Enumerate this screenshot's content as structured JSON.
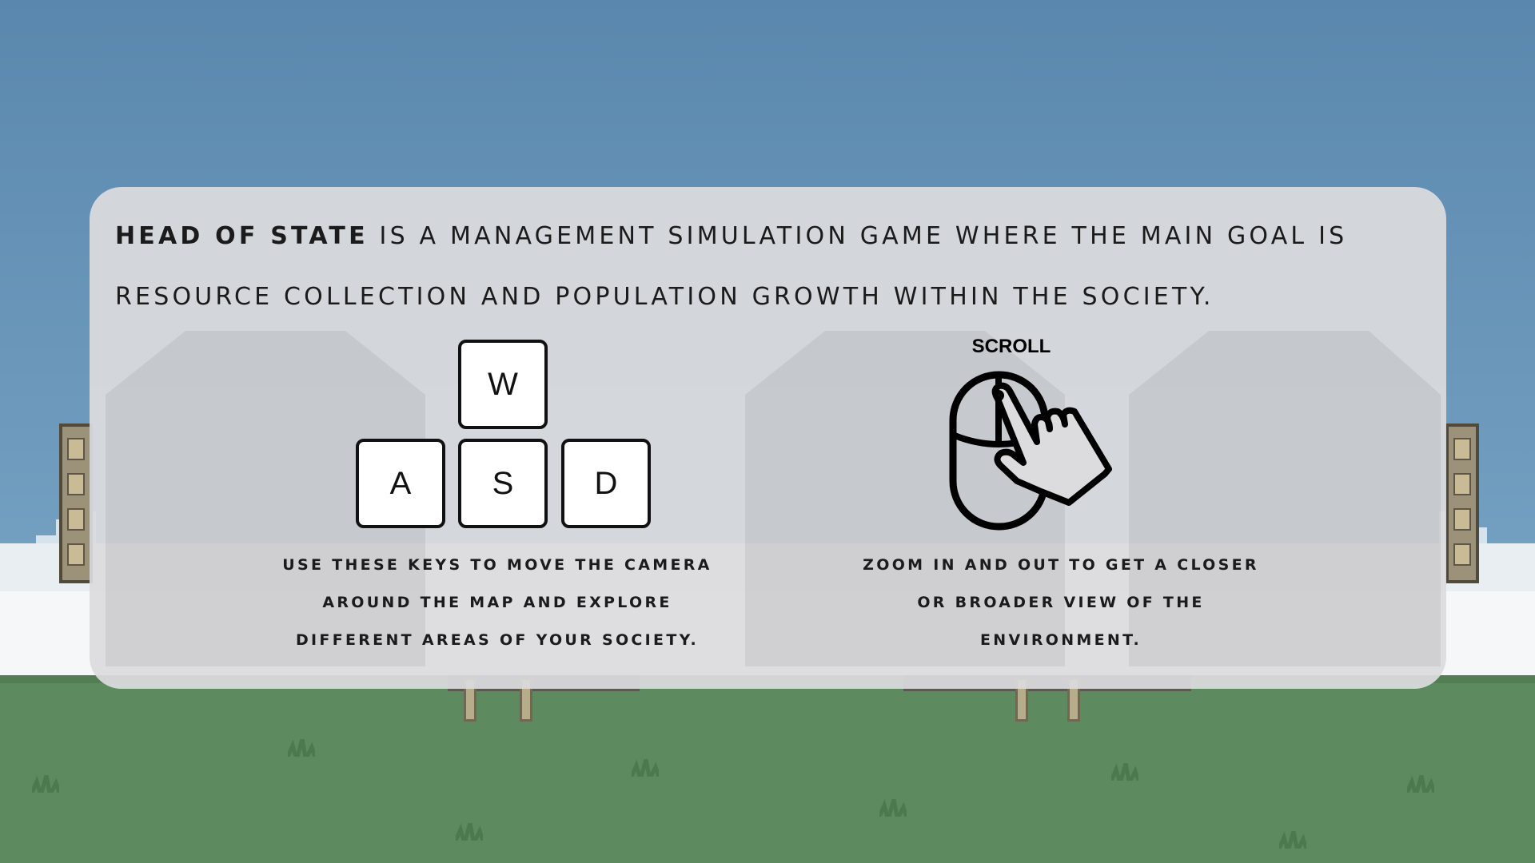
{
  "intro": {
    "title_bold": "HEAD OF STATE",
    "rest_line1": " IS A MANAGEMENT SIMULATION GAME WHERE THE MAIN GOAL IS",
    "line2": "RESOURCE COLLECTION AND POPULATION GROWTH WITHIN THE SOCIETY."
  },
  "movement": {
    "keys": [
      "W",
      "A",
      "S",
      "D"
    ],
    "caption_lines": [
      "USE THESE KEYS TO MOVE THE CAMERA",
      "AROUND THE MAP AND EXPLORE",
      "DIFFERENT AREAS OF YOUR SOCIETY."
    ]
  },
  "zoom": {
    "label": "SCROLL",
    "icon": "mouse-scroll-hand-icon",
    "caption_lines": [
      "ZOOM IN AND OUT TO GET A CLOSER",
      "OR BROADER VIEW OF THE",
      "ENVIRONMENT."
    ]
  },
  "colors": {
    "sky_top": "#5a87ad",
    "sky_bottom": "#6e9cbf",
    "grass": "#5e8a5f",
    "panel": "#dcdcde"
  }
}
